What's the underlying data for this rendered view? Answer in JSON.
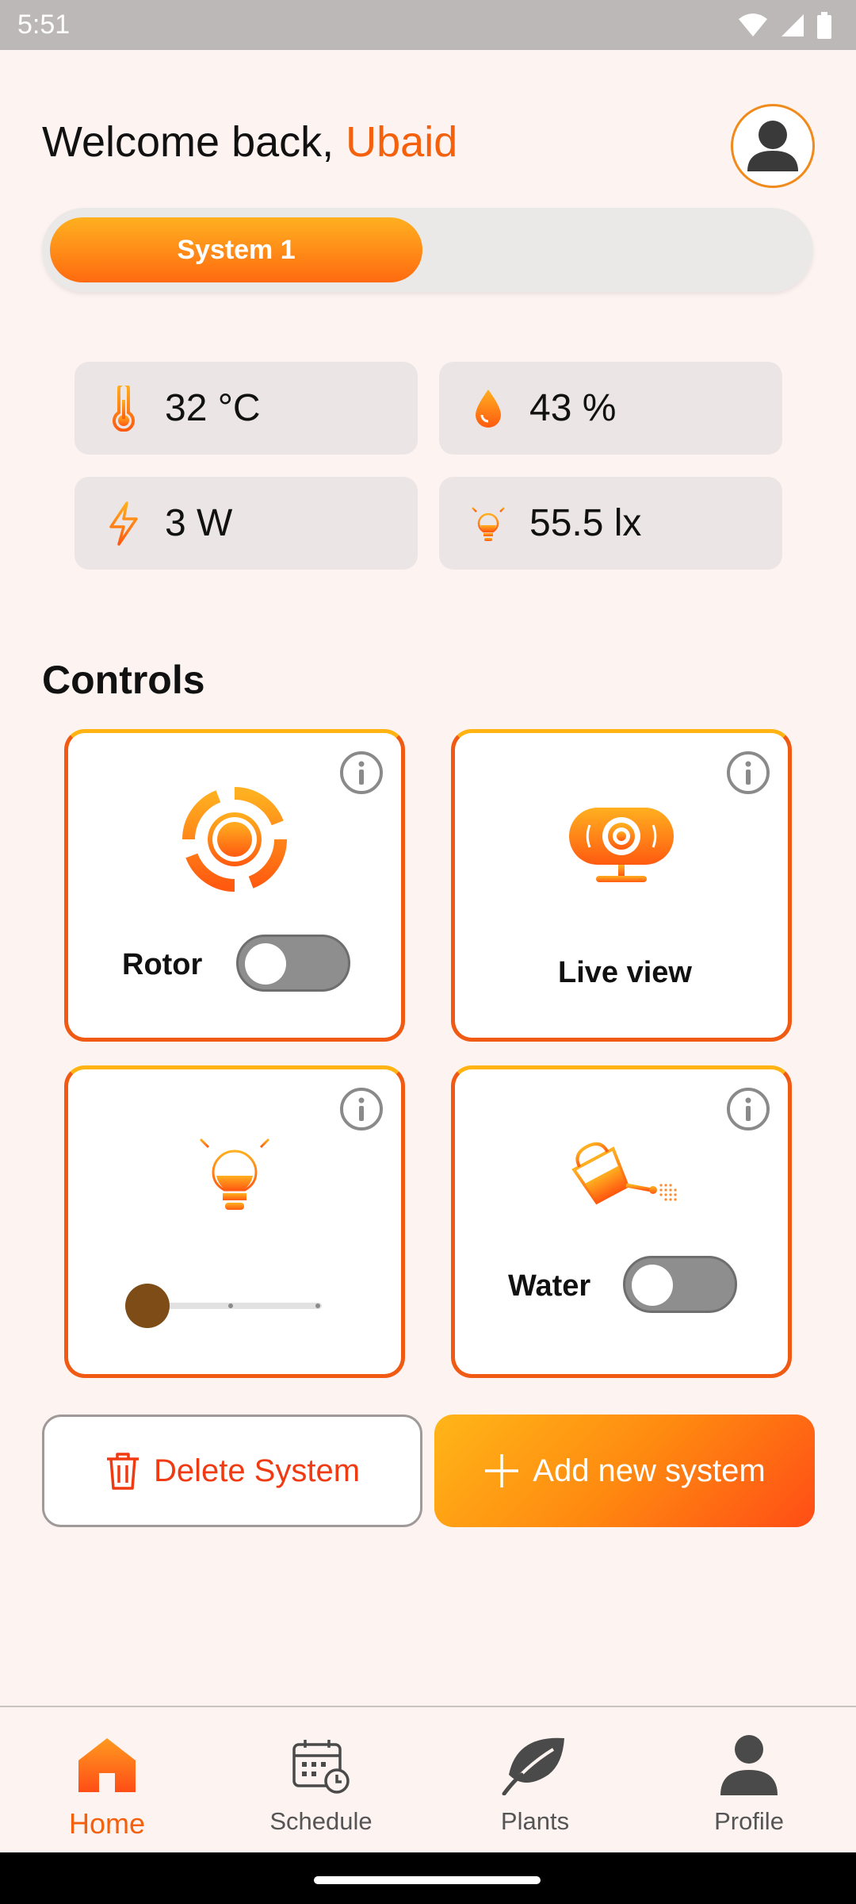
{
  "status_bar": {
    "time": "5:51"
  },
  "header": {
    "welcome_prefix": "Welcome back,",
    "user_name": "Ubaid"
  },
  "system_tabs": {
    "active": "System 1"
  },
  "stats": {
    "temperature": "32 °C",
    "humidity": "43 %",
    "power": "3 W",
    "light": "55.5 lx"
  },
  "controls": {
    "title": "Controls",
    "rotor": {
      "label": "Rotor",
      "on": false
    },
    "live_view": {
      "label": "Live view"
    },
    "lamp": {
      "slider_value": 0
    },
    "water": {
      "label": "Water",
      "on": false
    }
  },
  "actions": {
    "delete_label": "Delete System",
    "add_label": "Add new system"
  },
  "nav": {
    "home": "Home",
    "schedule": "Schedule",
    "plants": "Plants",
    "profile": "Profile",
    "active": "Home"
  },
  "colors": {
    "accent": "#f4600c",
    "gradient_start": "#ffb020",
    "gradient_end": "#ff4d16",
    "background": "#fdf3f1"
  }
}
